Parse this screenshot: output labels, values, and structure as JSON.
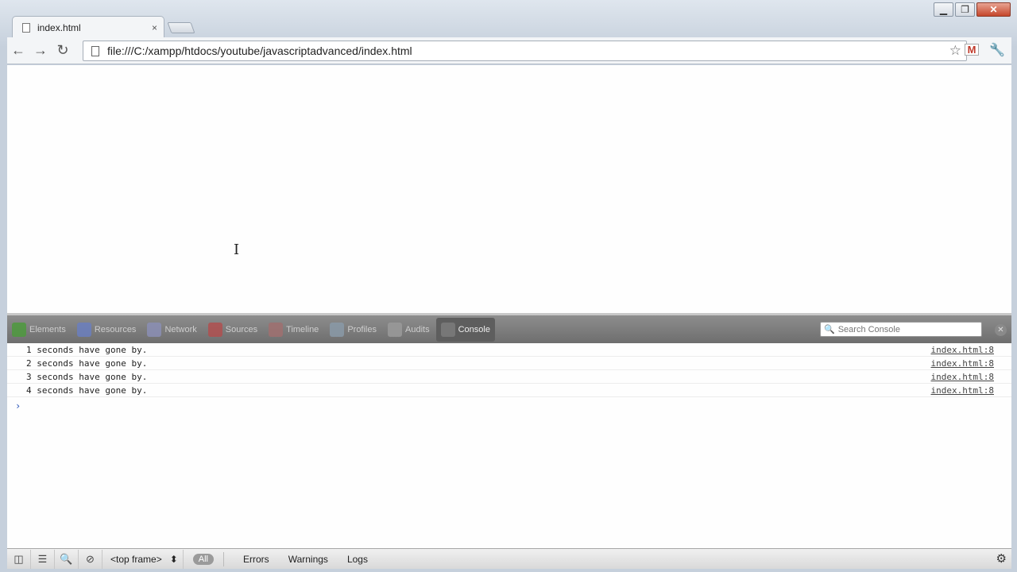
{
  "tab": {
    "title": "index.html",
    "close": "×"
  },
  "window_controls": {
    "minimize": "▁",
    "maximize": "❐",
    "close": "✕"
  },
  "toolbar": {
    "url": "file:///C:/xampp/htdocs/youtube/javascriptadvanced/index.html",
    "gmail_label": "M"
  },
  "devtools": {
    "tabs": [
      {
        "label": "Elements",
        "icon": "elements-icon",
        "color": "#4e9a3e"
      },
      {
        "label": "Resources",
        "icon": "resources-icon",
        "color": "#6b7fbf"
      },
      {
        "label": "Network",
        "icon": "network-icon",
        "color": "#8b8fb5"
      },
      {
        "label": "Sources",
        "icon": "sources-icon",
        "color": "#b05050"
      },
      {
        "label": "Timeline",
        "icon": "timeline-icon",
        "color": "#a07070"
      },
      {
        "label": "Profiles",
        "icon": "profiles-icon",
        "color": "#8a9aa8"
      },
      {
        "label": "Audits",
        "icon": "audits-icon",
        "color": "#9a9a9a"
      },
      {
        "label": "Console",
        "icon": "console-icon",
        "color": "#777777"
      }
    ],
    "search_placeholder": "Search Console",
    "console_rows": [
      {
        "message": "1 seconds have gone by.",
        "source": "index.html:8"
      },
      {
        "message": "2 seconds have gone by.",
        "source": "index.html:8"
      },
      {
        "message": "3 seconds have gone by.",
        "source": "index.html:8"
      },
      {
        "message": "4 seconds have gone by.",
        "source": "index.html:8"
      }
    ],
    "prompt": "›",
    "status_bar": {
      "frame": "<top frame>",
      "frame_arrows": "⬍",
      "filter_all": "All",
      "filters": [
        "Errors",
        "Warnings",
        "Logs"
      ]
    }
  }
}
